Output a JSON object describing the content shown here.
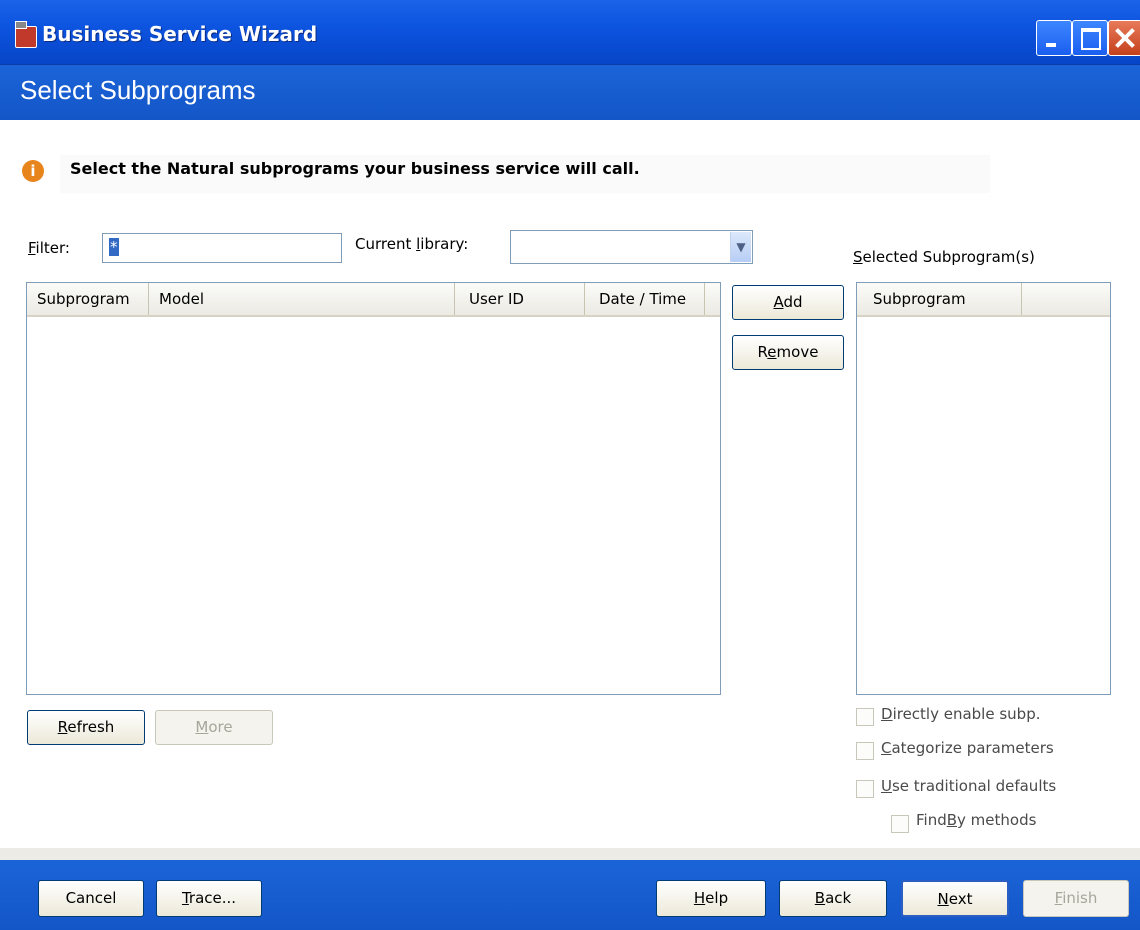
{
  "window": {
    "title": "Business Service Wizard"
  },
  "header": {
    "title": "Select Subprograms"
  },
  "info": {
    "message": "Select the Natural subprograms your business service will call."
  },
  "filter": {
    "label": "Filter:",
    "value": "*"
  },
  "library": {
    "label": "Current library:",
    "value": ""
  },
  "available_list": {
    "columns": [
      "Subprogram",
      "Model",
      "User ID",
      "Date / Time"
    ],
    "rows": []
  },
  "selected_list": {
    "label": "Selected Subprogram(s)",
    "columns": [
      "Subprogram"
    ],
    "rows": []
  },
  "buttons": {
    "add": "Add",
    "remove": "Remove",
    "refresh": "Refresh",
    "more": "More"
  },
  "options": {
    "directly_enable": "Directly enable subp.",
    "categorize": "Categorize parameters",
    "traditional": "Use traditional defaults",
    "findby": "FindBy methods"
  },
  "footer": {
    "cancel": "Cancel",
    "trace": "Trace...",
    "help": "Help",
    "back": "Back",
    "next": "Next",
    "finish": "Finish"
  }
}
